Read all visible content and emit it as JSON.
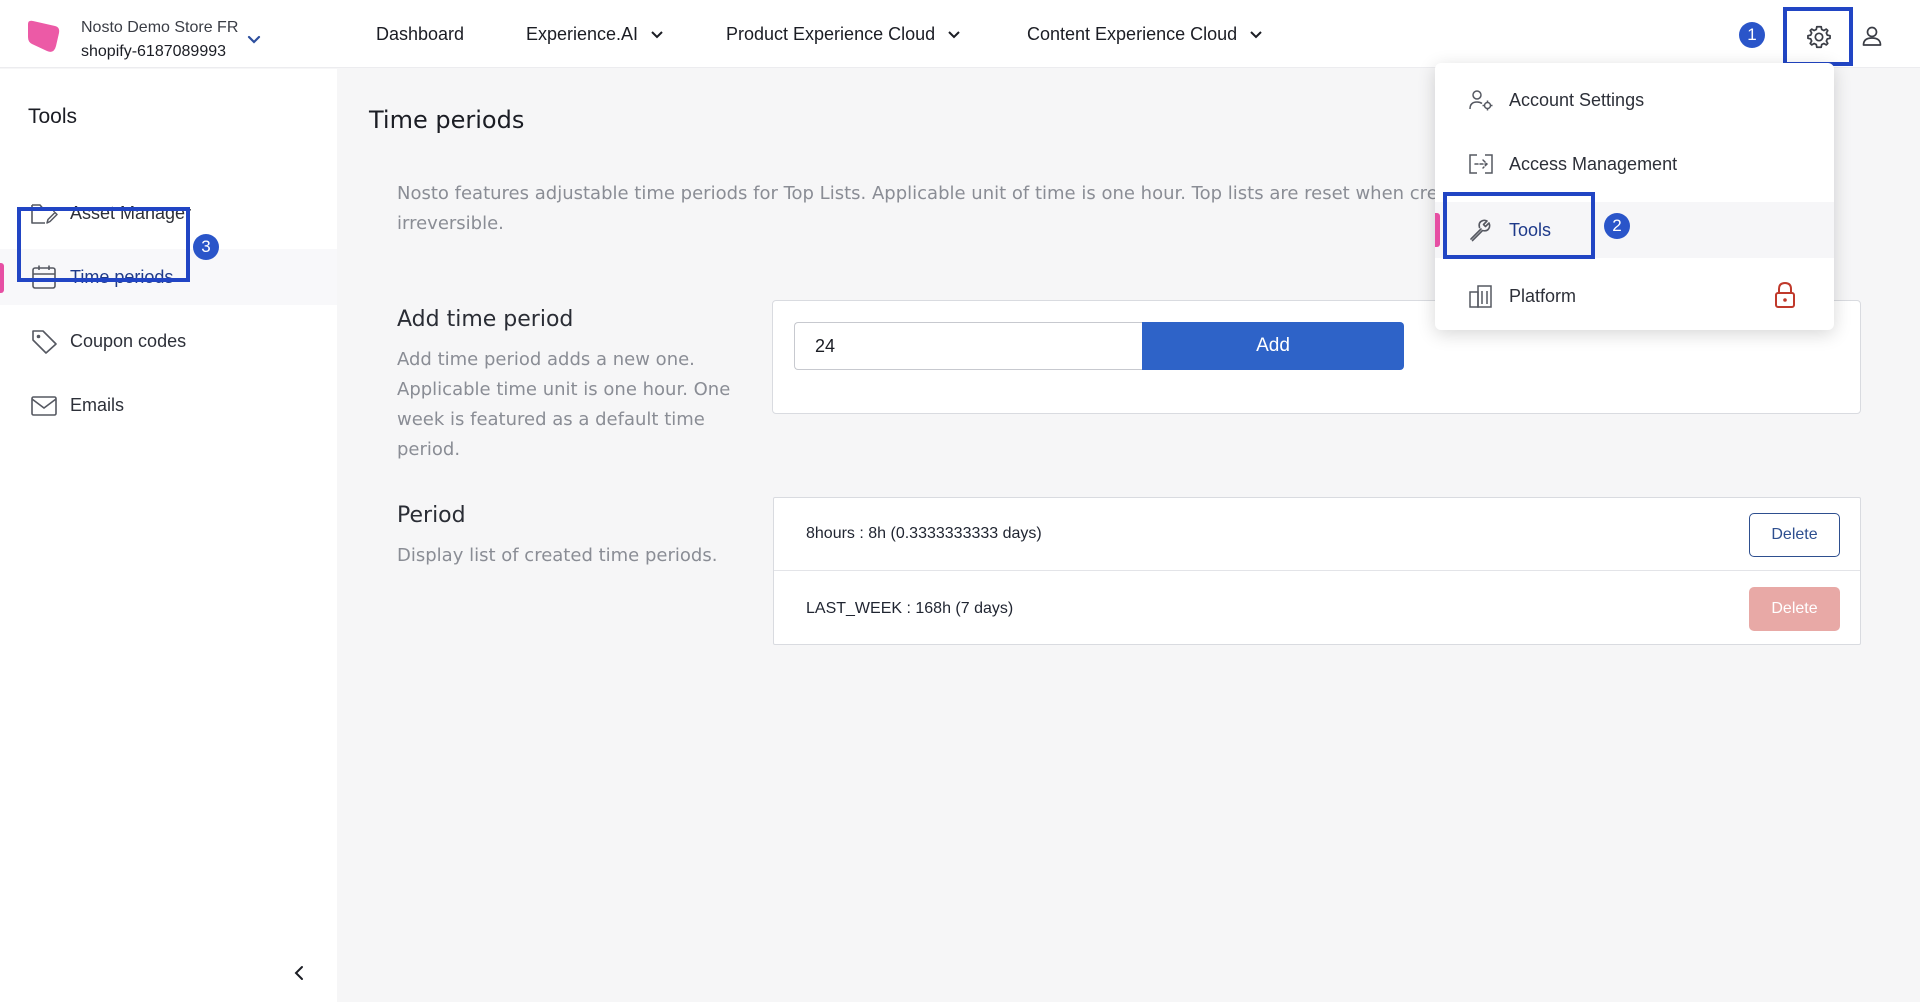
{
  "store": {
    "name": "Nosto Demo Store FR",
    "id": "shopify-6187089993"
  },
  "nav": [
    {
      "label": "Dashboard"
    },
    {
      "label": "Experience.AI"
    },
    {
      "label": "Product Experience Cloud"
    },
    {
      "label": "Content Experience Cloud"
    }
  ],
  "badges": {
    "one": "1",
    "two": "2",
    "three": "3"
  },
  "sidebar": {
    "title": "Tools",
    "items": [
      {
        "label": "Asset Manager",
        "icon": "folder-edit-icon"
      },
      {
        "label": "Time periods",
        "icon": "calendar-icon"
      },
      {
        "label": "Coupon codes",
        "icon": "tag-icon"
      },
      {
        "label": "Emails",
        "icon": "mail-icon"
      }
    ]
  },
  "main": {
    "title": "Time periods",
    "description": "Nosto features adjustable time periods for Top Lists. Applicable unit of time is one hour. Top lists are reset when creating new time period and the change is irreversible.",
    "add_section": {
      "title": "Add time period",
      "text": "Add time period adds a new one. Applicable time unit is one hour. One week is featured as a default time period.",
      "input_value": "24",
      "button": "Add"
    },
    "period_section": {
      "title": "Period",
      "text": "Display list of created time periods.",
      "rows": [
        {
          "label": "8hours : 8h (0.3333333333 days)",
          "button": "Delete"
        },
        {
          "label": "LAST_WEEK : 168h (7 days)",
          "button": "Delete"
        }
      ]
    }
  },
  "menu": {
    "items": [
      {
        "label": "Account Settings",
        "icon": "user-settings-icon"
      },
      {
        "label": "Access Management",
        "icon": "access-icon"
      },
      {
        "label": "Tools",
        "icon": "wrench-icon"
      },
      {
        "label": "Platform",
        "icon": "building-icon"
      }
    ]
  },
  "colors": {
    "accent": "#2e63c8",
    "highlight": "#2145c4",
    "brand_pink": "#e64fa3",
    "delete_disabled": "#e8a9a6"
  }
}
